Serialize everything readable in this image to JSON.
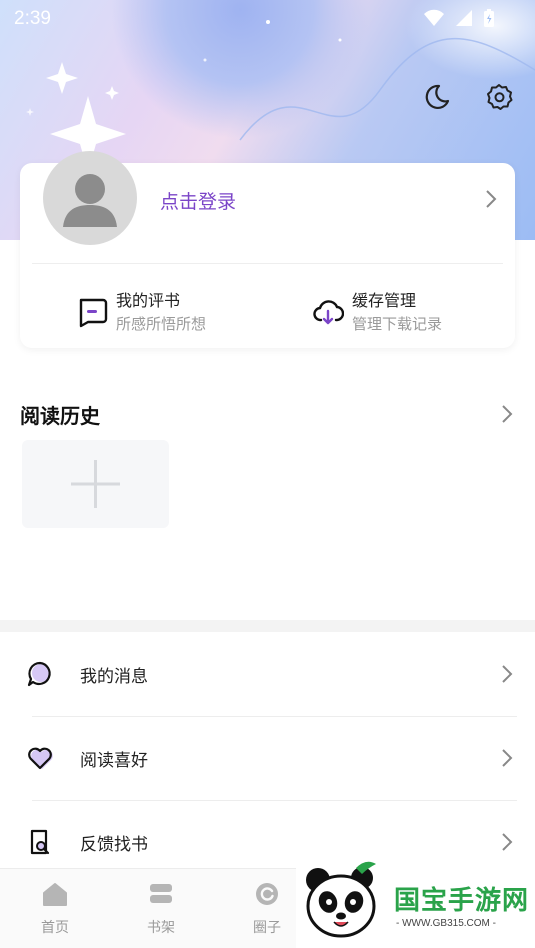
{
  "status_bar": {
    "time": "2:39"
  },
  "header": {
    "night_mode_icon": "moon-icon",
    "settings_icon": "gear-icon"
  },
  "profile": {
    "login_label": "点击登录",
    "items": [
      {
        "title": "我的评书",
        "subtitle": "所感所悟所想",
        "icon": "comment-box-icon"
      },
      {
        "title": "缓存管理",
        "subtitle": "管理下载记录",
        "icon": "cloud-download-icon"
      }
    ]
  },
  "history": {
    "title": "阅读历史"
  },
  "menu": [
    {
      "label": "我的消息",
      "icon": "message-bubble-icon"
    },
    {
      "label": "阅读喜好",
      "icon": "heart-icon"
    },
    {
      "label": "反馈找书",
      "icon": "search-book-icon"
    }
  ],
  "tabbar": [
    {
      "label": "首页",
      "icon": "home-icon"
    },
    {
      "label": "书架",
      "icon": "bookshelf-icon"
    },
    {
      "label": "圈子",
      "icon": "circle-icon"
    }
  ],
  "watermark": {
    "brand": "国宝手游网",
    "url": "- WWW.GB315.COM -"
  },
  "colors": {
    "accent": "#7b45c8",
    "muted_text": "#9a9a9a"
  }
}
